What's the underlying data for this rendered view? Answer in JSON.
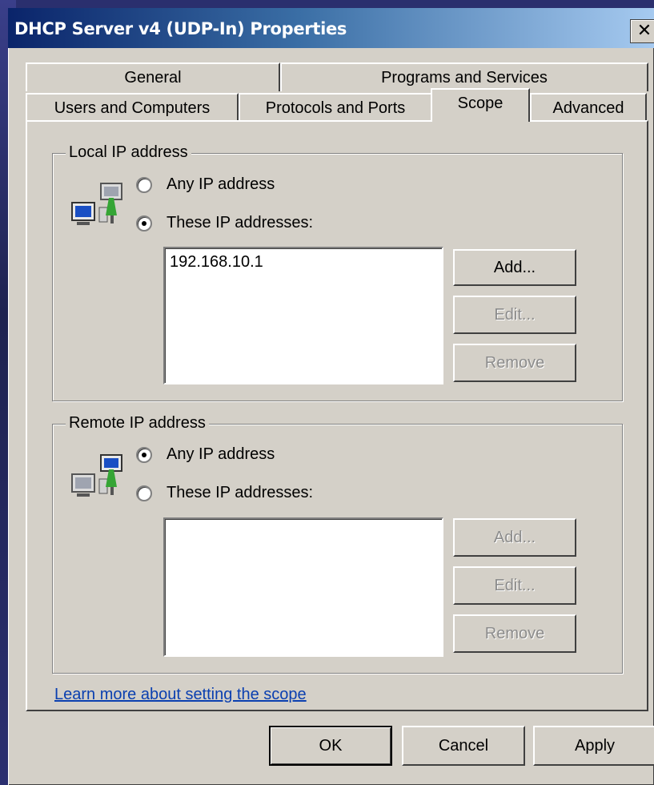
{
  "window": {
    "title": "DHCP Server v4 (UDP-In) Properties",
    "close_glyph": "✕"
  },
  "tabs": {
    "row1": [
      {
        "label": "General"
      },
      {
        "label": "Programs and Services"
      }
    ],
    "row2": [
      {
        "label": "Users and Computers"
      },
      {
        "label": "Protocols and Ports"
      },
      {
        "label": "Scope",
        "active": true
      },
      {
        "label": "Advanced"
      }
    ]
  },
  "local": {
    "legend": "Local IP address",
    "icon": "network-computers-icon",
    "radio_any": {
      "label": "Any IP address",
      "checked": false
    },
    "radio_these": {
      "label": "These IP addresses:",
      "checked": true
    },
    "addresses": [
      "192.168.10.1"
    ],
    "buttons": {
      "add": {
        "label": "Add...",
        "enabled": true
      },
      "edit": {
        "label": "Edit...",
        "enabled": false
      },
      "remove": {
        "label": "Remove",
        "enabled": false
      }
    }
  },
  "remote": {
    "legend": "Remote IP address",
    "icon": "network-computers-icon",
    "radio_any": {
      "label": "Any IP address",
      "checked": true
    },
    "radio_these": {
      "label": "These IP addresses:",
      "checked": false
    },
    "addresses": [],
    "buttons": {
      "add": {
        "label": "Add...",
        "enabled": false
      },
      "edit": {
        "label": "Edit...",
        "enabled": false
      },
      "remove": {
        "label": "Remove",
        "enabled": false
      }
    }
  },
  "link": {
    "label": "Learn more about setting the scope"
  },
  "footer": {
    "ok": "OK",
    "cancel": "Cancel",
    "apply": "Apply"
  },
  "colors": {
    "dialog_bg": "#d4d0c8",
    "titlebar_start": "#0a246a",
    "titlebar_end": "#a6caf0",
    "link": "#0a3fb0",
    "disabled_text": "#8c8c8c"
  }
}
